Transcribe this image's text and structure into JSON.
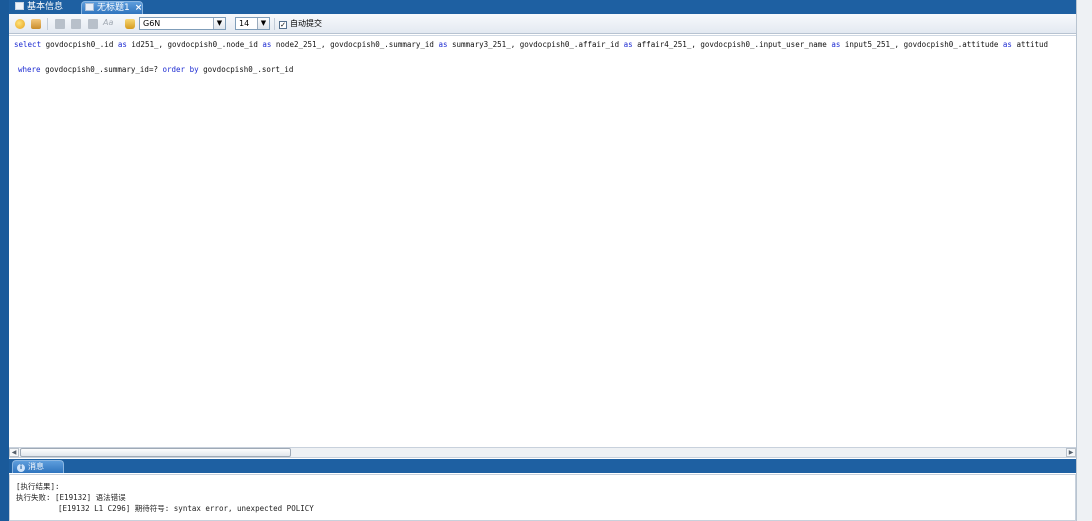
{
  "tabs": [
    {
      "label": "基本信息",
      "active": false
    },
    {
      "label": "无标题1",
      "active": true,
      "close_label": "×"
    }
  ],
  "toolbar": {
    "font_glyph": "Aa",
    "database_value": "G6N",
    "font_size_value": "14",
    "dropdown_arrow": "▼",
    "auto_commit_label": "自动提交",
    "auto_commit_checked": "✓"
  },
  "editor": {
    "line1_prefix": "select",
    "line1_parts": [
      {
        "text": " govdocpish0_.id ",
        "kw": false
      },
      {
        "text": "as",
        "kw": true
      },
      {
        "text": " id251_, govdocpish0_.node_id ",
        "kw": false
      },
      {
        "text": "as",
        "kw": true
      },
      {
        "text": " node2_251_, govdocpish0_.summary_id ",
        "kw": false
      },
      {
        "text": "as",
        "kw": true
      },
      {
        "text": " summary3_251_, govdocpish0_.affair_id ",
        "kw": false
      },
      {
        "text": "as",
        "kw": true
      },
      {
        "text": " affair4_251_, govdocpish0_.input_user_name ",
        "kw": false
      },
      {
        "text": "as",
        "kw": true
      },
      {
        "text": " input5_251_, govdocpish0_.attitude ",
        "kw": false
      },
      {
        "text": "as",
        "kw": true
      },
      {
        "text": " attitud",
        "kw": false
      }
    ],
    "line2_parts": [
      {
        "text": "where",
        "kw": true
      },
      {
        "text": " govdocpish0_.summary_id=? ",
        "kw": false
      },
      {
        "text": "order by",
        "kw": true
      },
      {
        "text": " govdocpish0_.sort_id",
        "kw": false
      }
    ]
  },
  "scrollbar": {
    "left_arrow": "◀",
    "right_arrow": "▶"
  },
  "messages_panel": {
    "tab_label": "消息",
    "info_glyph": "i",
    "lines": [
      "[执行结果]:",
      "执行失败: [E19132] 语法错误",
      "[E19132 L1 C296] 期待符号: syntax error, unexpected POLICY"
    ]
  },
  "colors": {
    "title_bar": "#1e60a2",
    "keyword": "#1d2bd2"
  }
}
